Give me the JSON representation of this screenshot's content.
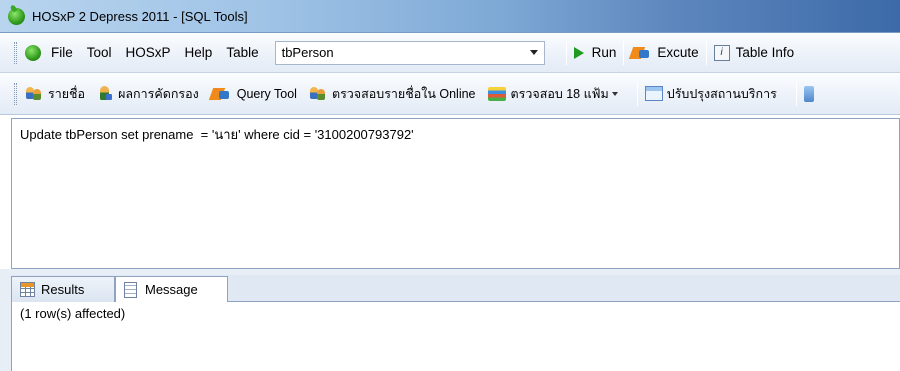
{
  "window": {
    "title": "HOSxP 2 Depress 2011 - [SQL Tools]",
    "icon": "hosxp-app-icon"
  },
  "menubar": {
    "items": [
      "File",
      "Tool",
      "HOSxP",
      "Help",
      "Table"
    ],
    "table_select": {
      "value": "tbPerson"
    },
    "run_label": "Run",
    "excute_label": "Excute",
    "table_info_label": "Table Info"
  },
  "toolbar": {
    "items": [
      {
        "label": "รายชื่อ",
        "icon": "people-icon"
      },
      {
        "label": "ผลการคัดกรอง",
        "icon": "person-icon"
      },
      {
        "label": "Query Tool",
        "icon": "excute-icon"
      },
      {
        "label": "ตรวจสอบรายชื่อใน Online",
        "icon": "people-icon"
      },
      {
        "label": "ตรวจสอบ 18 แฟ้ม",
        "icon": "stack-icon"
      },
      {
        "label": "ปรับปรุงสถานบริการ",
        "icon": "form-icon"
      }
    ]
  },
  "editor": {
    "sql": "Update tbPerson set prename  = 'นาย' where cid = '3100200793792'"
  },
  "tabs": [
    {
      "label": "Results",
      "icon": "grid-icon"
    },
    {
      "label": "Message",
      "icon": "doc-icon"
    }
  ],
  "output": {
    "message": "(1 row(s) affected)"
  },
  "colors": {
    "title_gradient_start": "#b8d4ee",
    "title_gradient_end": "#3c6aa8",
    "toolbar_bg": "#eef3fa",
    "run_green": "#1f9a1f"
  }
}
